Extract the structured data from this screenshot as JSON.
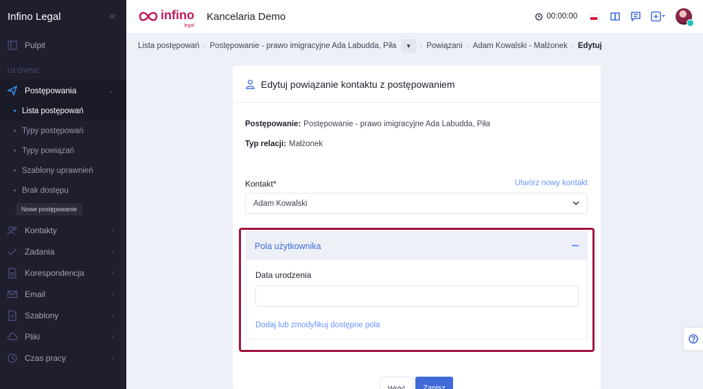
{
  "app": {
    "brand": "Infino Legal",
    "logo_text": "infino",
    "logo_sub": "legal",
    "workspace": "Kancelaria Demo"
  },
  "header": {
    "timer": "00:00:00"
  },
  "sidebar": {
    "dashboard": "Pulpit",
    "section_main": "GŁÓWNE",
    "proceedings": "Postępowania",
    "sub": [
      "Lista postępowań",
      "Typy postępowań",
      "Typy powiązań",
      "Szablony uprawnień",
      "Brak dostępu"
    ],
    "new_proceeding": "Nowe postępowanie",
    "items": [
      "Kontakty",
      "Zadania",
      "Korespondencja",
      "Email",
      "Szablony",
      "Pliki",
      "Czas pracy"
    ]
  },
  "breadcrumb": {
    "items": [
      "Lista postępowań",
      "Postępowanie - prawo imigracyjne Ada Labudda, Piła",
      "Powiązani",
      "Adam Kowalski - Małżonek"
    ],
    "current": "Edytuj"
  },
  "form": {
    "title": "Edytuj powiązanie kontaktu z postępowaniem",
    "proceeding_label": "Postępowanie:",
    "proceeding_value": "Postępowanie - prawo imigracyjne Ada Labudda, Piła",
    "relation_label": "Typ relacji:",
    "relation_value": "Małżonek",
    "contact_label": "Kontakt*",
    "create_contact_link": "Utwórz nowy kontakt",
    "contact_value": "Adam Kowalski",
    "user_fields_title": "Pola użytkownika",
    "birthdate_label": "Data urodzenia",
    "birthdate_value": "",
    "modify_fields_link": "Dodaj lub zmodyfikuj dostępne pola",
    "back_button": "Wróć",
    "save_button": "Zapisz"
  },
  "colors": {
    "accent": "#3f6ad8",
    "highlight": "#a0113d",
    "sidebar_bg": "#1e1e2d",
    "brand": "#c2185b"
  }
}
